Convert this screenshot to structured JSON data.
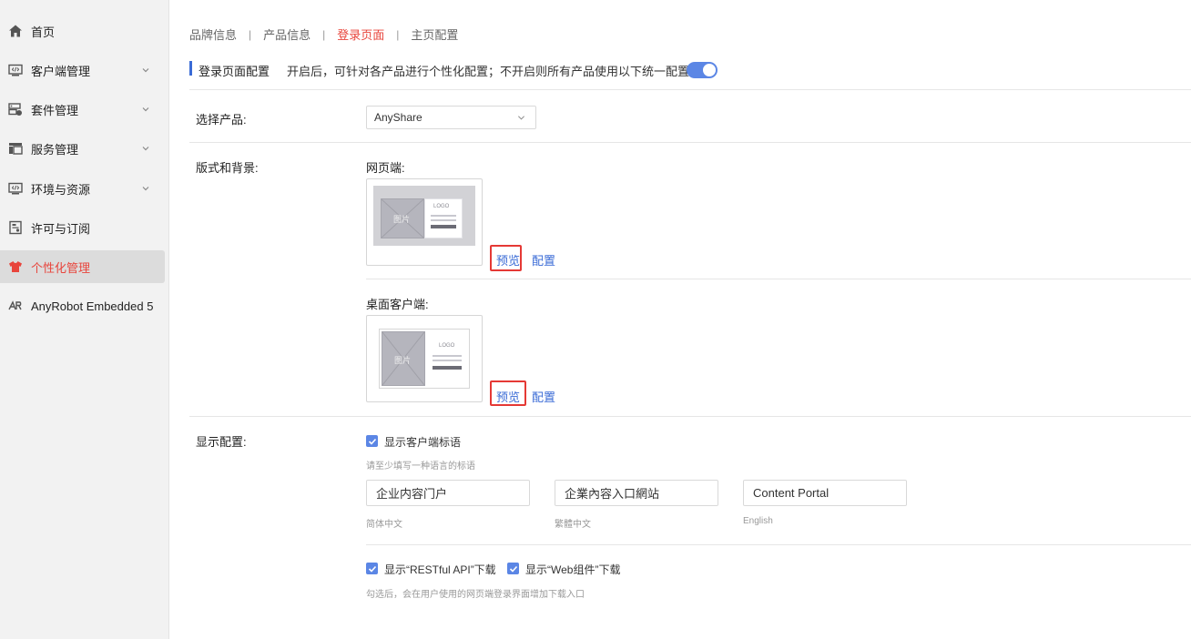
{
  "sidebar": {
    "items": [
      {
        "label": "首页",
        "icon": "home-icon",
        "has_chevron": false,
        "active": false
      },
      {
        "label": "客户端管理",
        "icon": "code-window-icon",
        "has_chevron": true,
        "active": false
      },
      {
        "label": "套件管理",
        "icon": "server-icon",
        "has_chevron": true,
        "active": false
      },
      {
        "label": "服务管理",
        "icon": "layout-icon",
        "has_chevron": true,
        "active": false
      },
      {
        "label": "环境与资源",
        "icon": "code-window-icon",
        "has_chevron": true,
        "active": false
      },
      {
        "label": "许可与订阅",
        "icon": "license-icon",
        "has_chevron": false,
        "active": false
      },
      {
        "label": "个性化管理",
        "icon": "tshirt-icon",
        "has_chevron": false,
        "active": true
      },
      {
        "label": "AnyRobot Embedded 5",
        "icon": "anyrobot-logo-icon",
        "has_chevron": false,
        "active": false
      }
    ]
  },
  "tabs": [
    {
      "label": "品牌信息",
      "active": false
    },
    {
      "label": "产品信息",
      "active": false
    },
    {
      "label": "登录页面",
      "active": true
    },
    {
      "label": "主页配置",
      "active": false
    }
  ],
  "tab_separator": "|",
  "section": {
    "title": "登录页面配置",
    "description": "开启后，可针对各产品进行个性化配置；不开启则所有产品使用以下统一配置",
    "toggle_on": true
  },
  "product": {
    "label": "选择产品:",
    "selected": "AnyShare"
  },
  "layout": {
    "label": "版式和背景:",
    "web": {
      "label": "网页端:",
      "thumb_image_text": "图片",
      "thumb_logo_text": "LOGO",
      "preview_label": "预览",
      "config_label": "配置"
    },
    "desktop": {
      "label": "桌面客户端:",
      "thumb_image_text": "图片",
      "thumb_logo_text": "LOGO",
      "preview_label": "预览",
      "config_label": "配置"
    }
  },
  "display": {
    "label": "显示配置:",
    "show_slogan": {
      "label": "显示客户端标语",
      "checked": true
    },
    "slogan_hint": "请至少填写一种语言的标语",
    "slogans": [
      {
        "value": "企业内容门户",
        "caption": "简体中文"
      },
      {
        "value": "企業內容入口網站",
        "caption": "繁體中文"
      },
      {
        "value": "Content Portal",
        "caption": "English"
      }
    ],
    "show_restful": {
      "label": "显示“RESTful API”下载",
      "checked": true
    },
    "show_web_component": {
      "label": "显示“Web组件”下载",
      "checked": true
    },
    "download_hint": "勾选后，会在用户使用的网页端登录界面增加下载入口"
  },
  "colors": {
    "accent_red": "#e8453c",
    "accent_blue": "#3a6bd6",
    "toggle_blue": "#5b86e5",
    "highlight_red": "#e53935"
  }
}
